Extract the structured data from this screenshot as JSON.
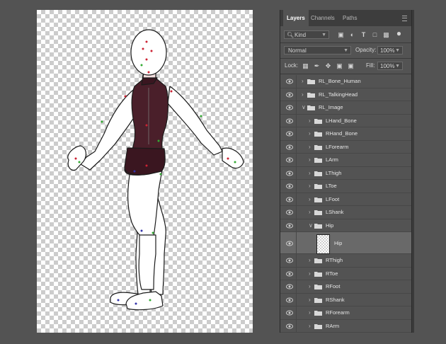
{
  "panel": {
    "tabs": [
      "Layers",
      "Channels",
      "Paths"
    ],
    "filter": {
      "label": "Kind"
    },
    "blend_mode": "Normal",
    "opacity_label": "Opacity:",
    "opacity_value": "100%",
    "lock_label": "Lock:",
    "fill_label": "Fill:",
    "fill_value": "100%",
    "toolbar_icons": [
      "image-filter-icon",
      "adjustment-filter-icon",
      "type-filter-icon",
      "shape-filter-icon",
      "smart-object-filter-icon",
      "filter-toggle-icon"
    ],
    "lock_icons": [
      "lock-transparent-icon",
      "lock-image-icon",
      "lock-position-icon",
      "lock-artboard-icon",
      "lock-all-icon"
    ]
  },
  "layers": [
    {
      "name": "RL_Bone_Human",
      "type": "group",
      "level": 0,
      "expanded": false
    },
    {
      "name": "RL_TalkingHead",
      "type": "group",
      "level": 0,
      "expanded": false
    },
    {
      "name": "RL_Image",
      "type": "group",
      "level": 0,
      "expanded": true
    },
    {
      "name": "LHand_Bone",
      "type": "group",
      "level": 1,
      "expanded": false
    },
    {
      "name": "RHand_Bone",
      "type": "group",
      "level": 1,
      "expanded": false
    },
    {
      "name": "LForearm",
      "type": "group",
      "level": 1,
      "expanded": false
    },
    {
      "name": "LArm",
      "type": "group",
      "level": 1,
      "expanded": false
    },
    {
      "name": "LThigh",
      "type": "group",
      "level": 1,
      "expanded": false
    },
    {
      "name": "LToe",
      "type": "group",
      "level": 1,
      "expanded": false
    },
    {
      "name": "LFoot",
      "type": "group",
      "level": 1,
      "expanded": false
    },
    {
      "name": "LShank",
      "type": "group",
      "level": 1,
      "expanded": false
    },
    {
      "name": "Hip",
      "type": "group",
      "level": 1,
      "expanded": true
    },
    {
      "name": "Hip",
      "type": "layer",
      "level": 2,
      "selected": true
    },
    {
      "name": "RThigh",
      "type": "group",
      "level": 1,
      "expanded": false
    },
    {
      "name": "RToe",
      "type": "group",
      "level": 1,
      "expanded": false
    },
    {
      "name": "RFoot",
      "type": "group",
      "level": 1,
      "expanded": false
    },
    {
      "name": "RShank",
      "type": "group",
      "level": 1,
      "expanded": false
    },
    {
      "name": "RForearm",
      "type": "group",
      "level": 1,
      "expanded": false
    },
    {
      "name": "RArm",
      "type": "group",
      "level": 1,
      "expanded": false
    }
  ],
  "colors": {
    "outfit": "#4a1f2a",
    "skin": "#ffffff",
    "panel_bg": "#535353",
    "selected_row": "#696969"
  }
}
